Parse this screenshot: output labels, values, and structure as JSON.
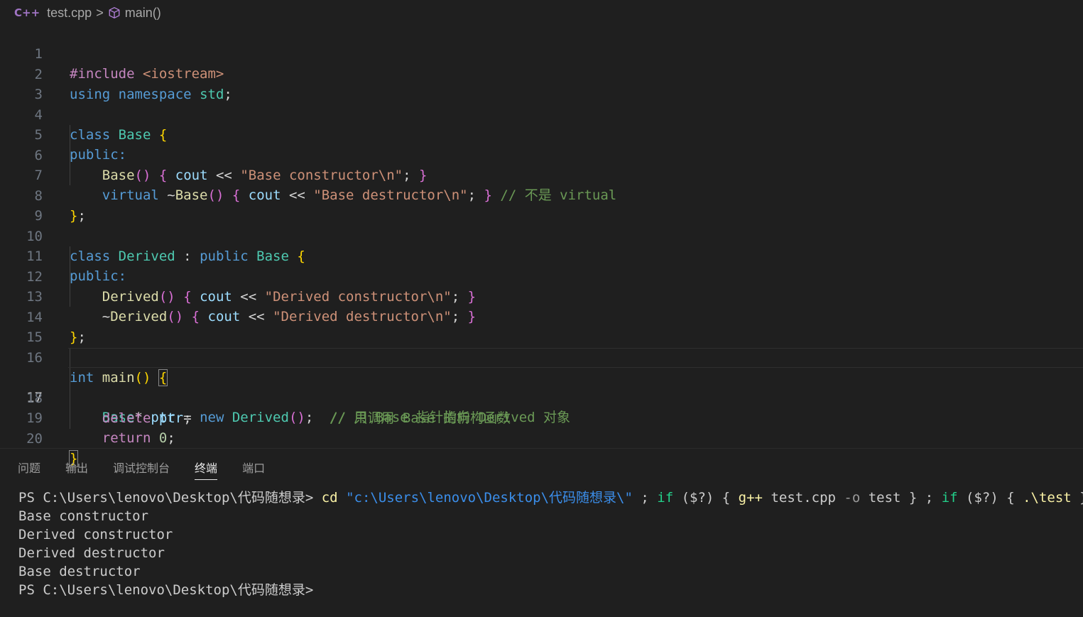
{
  "breadcrumb": {
    "file_icon": "C++",
    "file": "test.cpp",
    "separator": ">",
    "symbol": "main()"
  },
  "editor": {
    "current_line": 17,
    "lines": [
      {
        "n": "1"
      },
      {
        "n": "2"
      },
      {
        "n": "3"
      },
      {
        "n": "4"
      },
      {
        "n": "5"
      },
      {
        "n": "6"
      },
      {
        "n": "7"
      },
      {
        "n": "8"
      },
      {
        "n": "9"
      },
      {
        "n": "10"
      },
      {
        "n": "11"
      },
      {
        "n": "12"
      },
      {
        "n": "13"
      },
      {
        "n": "14"
      },
      {
        "n": "15"
      },
      {
        "n": "16"
      },
      {
        "n": "17"
      },
      {
        "n": "18"
      },
      {
        "n": "19"
      },
      {
        "n": "20"
      }
    ],
    "code": {
      "l1": [
        "#include",
        " ",
        "<iostream>"
      ],
      "l2": [
        "using",
        " ",
        "namespace",
        " ",
        "std",
        ";"
      ],
      "l4": [
        "class",
        " ",
        "Base",
        " ",
        "{"
      ],
      "l5": [
        "public",
        ":"
      ],
      "l6": [
        "    ",
        "Base",
        "()",
        " ",
        "{",
        " ",
        "cout",
        " << ",
        "\"Base constructor\\n\"",
        "; ",
        "}"
      ],
      "l7": [
        "    ",
        "virtual",
        " ~",
        "Base",
        "()",
        " ",
        "{",
        " ",
        "cout",
        " << ",
        "\"Base destructor\\n\"",
        "; ",
        "}",
        " ",
        "// 不是 virtual"
      ],
      "l8": [
        "}",
        ";"
      ],
      "l10": [
        "class",
        " ",
        "Derived",
        " : ",
        "public",
        " ",
        "Base",
        " ",
        "{"
      ],
      "l11": [
        "public",
        ":"
      ],
      "l12": [
        "    ",
        "Derived",
        "()",
        " ",
        "{",
        " ",
        "cout",
        " << ",
        "\"Derived constructor\\n\"",
        "; ",
        "}"
      ],
      "l13": [
        "    ~",
        "Derived",
        "()",
        " ",
        "{",
        " ",
        "cout",
        " << ",
        "\"Derived destructor\\n\"",
        "; ",
        "}"
      ],
      "l14": [
        "}",
        ";"
      ],
      "l16": [
        "int",
        " ",
        "main",
        "()",
        " ",
        "{"
      ],
      "l17": [
        "    ",
        "Base",
        "* ",
        "ptr",
        " = ",
        "new",
        " ",
        "Derived",
        "()",
        ";  ",
        "// 用 Base 指针指向 Derived 对象"
      ],
      "l18": [
        "    ",
        "delete",
        " ",
        "ptr",
        ";                 ",
        "// 只调用 Base 的析构函数"
      ],
      "l19": [
        "    ",
        "return",
        " ",
        "0",
        ";"
      ],
      "l20": [
        "}"
      ]
    }
  },
  "panel": {
    "tabs": [
      {
        "label": "问题",
        "active": false
      },
      {
        "label": "输出",
        "active": false
      },
      {
        "label": "调试控制台",
        "active": false
      },
      {
        "label": "终端",
        "active": true
      },
      {
        "label": "端口",
        "active": false
      }
    ]
  },
  "terminal": {
    "prompt": "PS C:\\Users\\lenovo\\Desktop\\代码随想录> ",
    "cmd": {
      "cd": "cd",
      "path": "\"c:\\Users\\lenovo\\Desktop\\代码随想录\\\"",
      "semi1": " ; ",
      "if1": "if",
      "cond1": " ($?) { ",
      "gpp": "g++",
      "args1": " test.cpp ",
      "flag": "-o",
      "args2": " test } ",
      "semi2": "; ",
      "if2": "if",
      "cond2": " ($?) { ",
      "exe": ".\\test",
      "end": " }"
    },
    "output": [
      "Base constructor",
      "Derived constructor",
      "Derived destructor",
      "Base destructor"
    ],
    "final_prompt": "PS C:\\Users\\lenovo\\Desktop\\代码随想录>"
  }
}
